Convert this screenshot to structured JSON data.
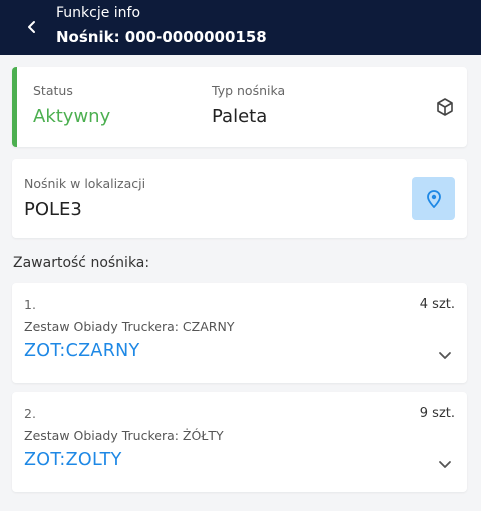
{
  "header": {
    "title": "Funkcje info",
    "subtitle": "Nośnik: 000-0000000158"
  },
  "status_card": {
    "status_label": "Status",
    "status_value": "Aktywny",
    "type_label": "Typ nośnika",
    "type_value": "Paleta",
    "status_color": "#4caf50"
  },
  "location_card": {
    "label": "Nośnik w lokalizacji",
    "value": "POLE3"
  },
  "content": {
    "title": "Zawartość nośnika:",
    "items": [
      {
        "index": "1.",
        "qty": "4 szt.",
        "desc": "Zestaw Obiady Truckera: CZARNY",
        "code": "ZOT:CZARNY"
      },
      {
        "index": "2.",
        "qty": "9 szt.",
        "desc": "Zestaw Obiady Truckera: ŻÓŁTY",
        "code": "ZOT:ZOLTY"
      }
    ]
  },
  "colors": {
    "header_bg": "#0d1b3a",
    "accent_blue": "#1e88e5",
    "pin_bg": "#bbdefb"
  },
  "icons": {
    "back": "chevron-left-icon",
    "type": "box-icon",
    "location": "map-pin-icon",
    "expand": "chevron-down-icon"
  }
}
